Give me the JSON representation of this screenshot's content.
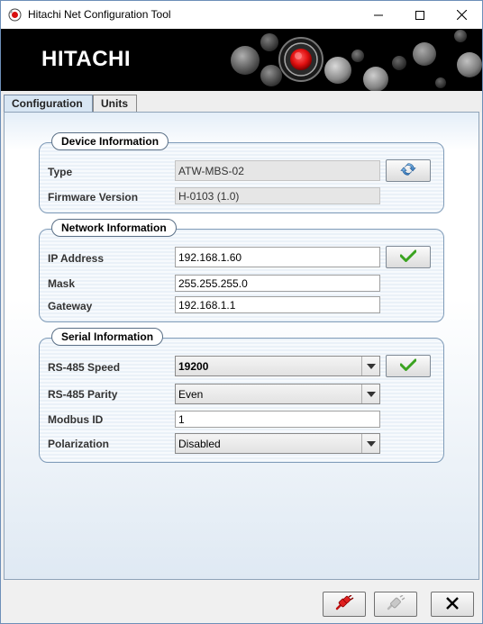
{
  "window": {
    "title": "Hitachi Net Configuration Tool",
    "minimize_icon": "minimize-icon",
    "maximize_icon": "maximize-icon",
    "close_icon": "close-icon"
  },
  "banner": {
    "brand": "HITACHI"
  },
  "tabs": [
    {
      "label": "Configuration",
      "active": true
    },
    {
      "label": "Units",
      "active": false
    }
  ],
  "device_information": {
    "title": "Device Information",
    "type_label": "Type",
    "type_value": "ATW-MBS-02",
    "firmware_label": "Firmware Version",
    "firmware_value": "H-0103 (1.0)",
    "refresh_icon": "refresh-icon"
  },
  "network_information": {
    "title": "Network Information",
    "ip_label": "IP Address",
    "ip_value": "192.168.1.60",
    "mask_label": "Mask",
    "mask_value": "255.255.255.0",
    "gateway_label": "Gateway",
    "gateway_value": "192.168.1.1",
    "apply_icon": "checkmark-icon"
  },
  "serial_information": {
    "title": "Serial Information",
    "speed_label": "RS-485 Speed",
    "speed_value": "19200",
    "parity_label": "RS-485 Parity",
    "parity_value": "Even",
    "modbus_label": "Modbus ID",
    "modbus_value": "1",
    "polarization_label": "Polarization",
    "polarization_value": "Disabled",
    "apply_icon": "checkmark-icon"
  },
  "footer": {
    "connect_icon": "plug-connect-icon",
    "disconnect_icon": "plug-disconnect-icon",
    "exit_icon": "close-icon"
  },
  "colors": {
    "banner_bg": "#000000",
    "accent_red": "#e01010",
    "check_green": "#3aa320",
    "panel_border": "#7f9bb8"
  }
}
